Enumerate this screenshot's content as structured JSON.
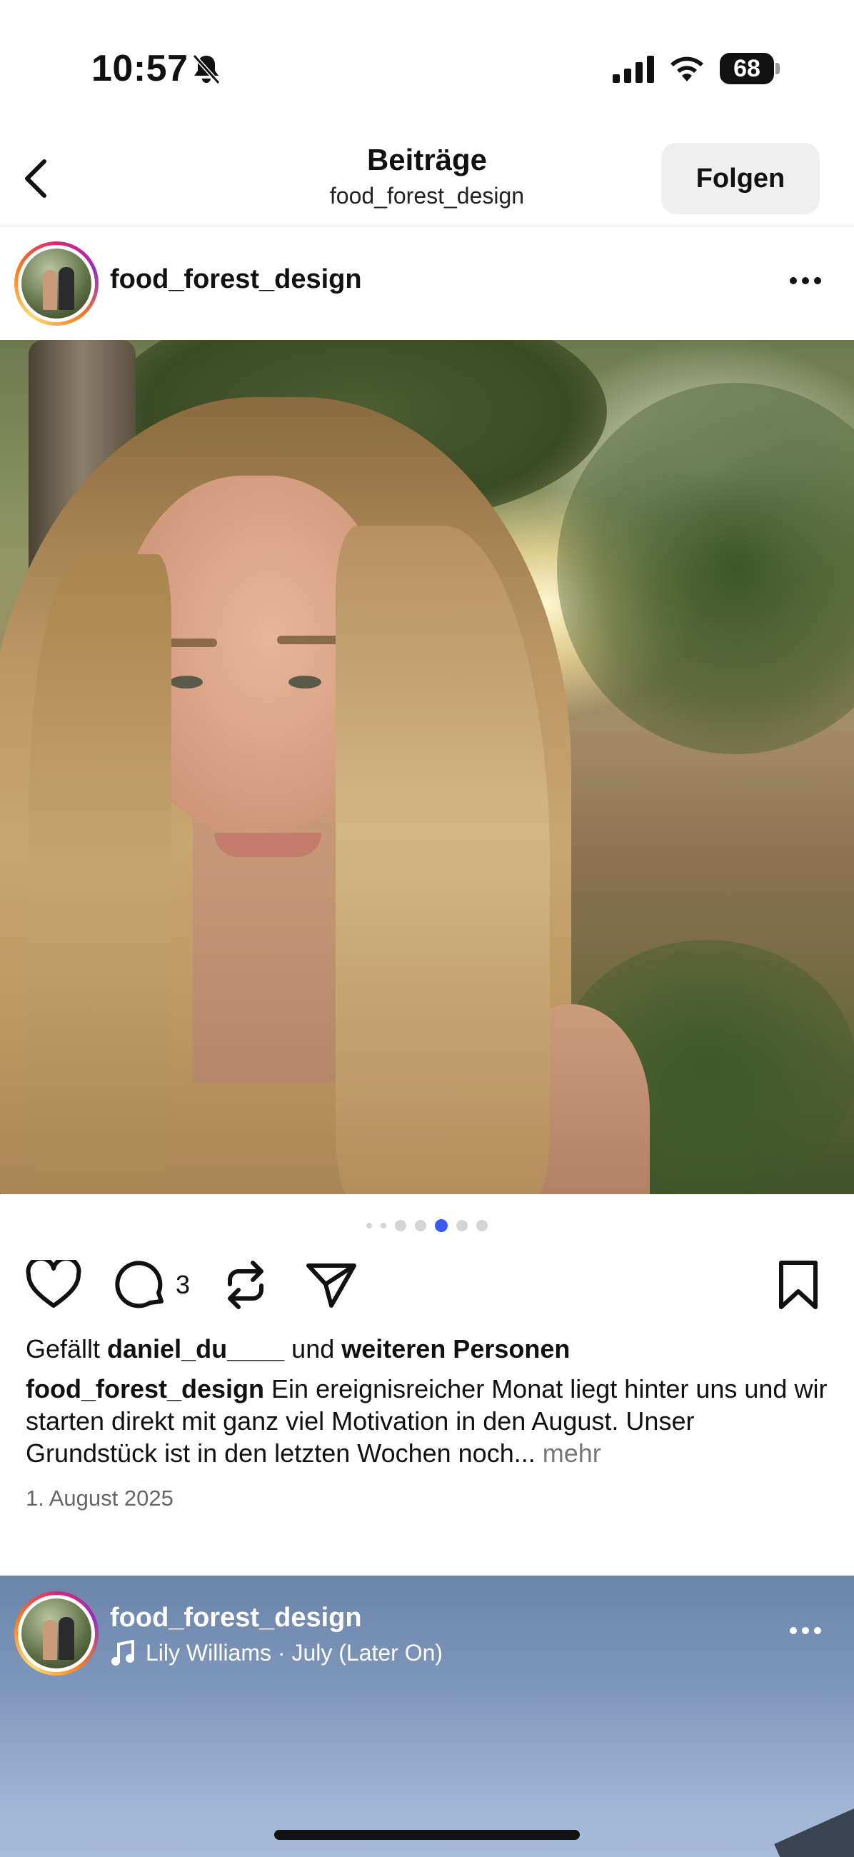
{
  "status_bar": {
    "time": "10:57",
    "battery": "68"
  },
  "nav": {
    "title": "Beiträge",
    "subtitle": "food_forest_design",
    "follow_label": "Folgen"
  },
  "post": {
    "username": "food_forest_design",
    "carousel": {
      "count": 7,
      "active_index": 4
    },
    "comment_count": "3",
    "likes": {
      "prefix": "Gefällt ",
      "user": "daniel_du____",
      "middle": " und ",
      "rest": "weiteren Personen"
    },
    "caption": {
      "user": "food_forest_design",
      "text": " Ein ereignisreicher Monat liegt hinter uns und wir starten direkt mit ganz viel Motivation in den August. Unser Grundstück ist in den letzten Wochen noch... ",
      "more": "mehr"
    },
    "date": "1. August 2025"
  },
  "next_post": {
    "username": "food_forest_design",
    "music": "Lily Williams · July (Later On)"
  },
  "icons": [
    "back-icon",
    "bell-slash-icon",
    "signal-icon",
    "wifi-icon",
    "more-icon",
    "heart-icon",
    "comment-icon",
    "repost-icon",
    "send-icon",
    "bookmark-icon",
    "music-icon"
  ]
}
